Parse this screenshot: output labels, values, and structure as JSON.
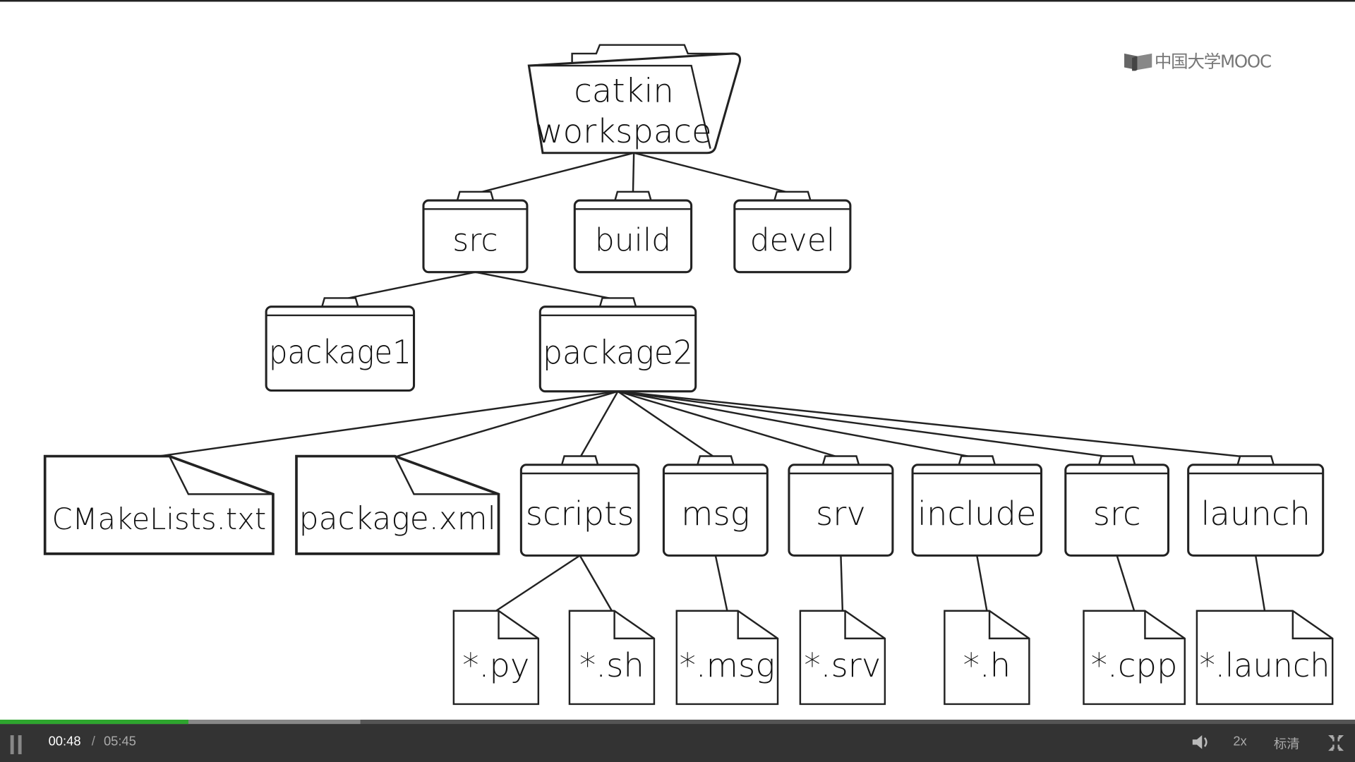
{
  "logo": {
    "text": "中国大学MOOC"
  },
  "diagram": {
    "root": {
      "id": "ws",
      "lines": [
        "catkin",
        "workspace"
      ],
      "kind": "open-folder"
    },
    "nodes": [
      {
        "id": "src",
        "label": "src",
        "kind": "folder",
        "parent": "ws"
      },
      {
        "id": "build",
        "label": "build",
        "kind": "folder",
        "parent": "ws"
      },
      {
        "id": "devel",
        "label": "devel",
        "kind": "folder",
        "parent": "ws"
      },
      {
        "id": "package1",
        "label": "package1",
        "kind": "folder",
        "parent": "src"
      },
      {
        "id": "package2",
        "label": "package2",
        "kind": "folder",
        "parent": "src"
      },
      {
        "id": "cmake",
        "label": "CMakeLists.txt",
        "kind": "file",
        "parent": "package2"
      },
      {
        "id": "pkgxml",
        "label": "package.xml",
        "kind": "file",
        "parent": "package2"
      },
      {
        "id": "scripts",
        "label": "scripts",
        "kind": "folder",
        "parent": "package2"
      },
      {
        "id": "msg",
        "label": "msg",
        "kind": "folder",
        "parent": "package2"
      },
      {
        "id": "srv",
        "label": "srv",
        "kind": "folder",
        "parent": "package2"
      },
      {
        "id": "include",
        "label": "include",
        "kind": "folder",
        "parent": "package2"
      },
      {
        "id": "src2",
        "label": "src",
        "kind": "folder",
        "parent": "package2"
      },
      {
        "id": "launch",
        "label": "launch",
        "kind": "folder",
        "parent": "package2"
      },
      {
        "id": "py",
        "label": "*.py",
        "kind": "file",
        "parent": "scripts"
      },
      {
        "id": "sh",
        "label": "*.sh",
        "kind": "file",
        "parent": "scripts"
      },
      {
        "id": "msgf",
        "label": "*.msg",
        "kind": "file",
        "parent": "msg"
      },
      {
        "id": "srvf",
        "label": "*.srv",
        "kind": "file",
        "parent": "srv"
      },
      {
        "id": "h",
        "label": "*.h",
        "kind": "file",
        "parent": "include"
      },
      {
        "id": "cpp",
        "label": "*.cpp",
        "kind": "file",
        "parent": "src2"
      },
      {
        "id": "launchf",
        "label": "*.launch",
        "kind": "file",
        "parent": "launch"
      }
    ]
  },
  "player": {
    "current_time": "00:48",
    "separator": "/",
    "duration": "05:45",
    "played_fraction": 0.139,
    "buffered_fraction": 0.266,
    "speed": "2x",
    "quality": "标清",
    "played_color": "#2ea52e"
  }
}
